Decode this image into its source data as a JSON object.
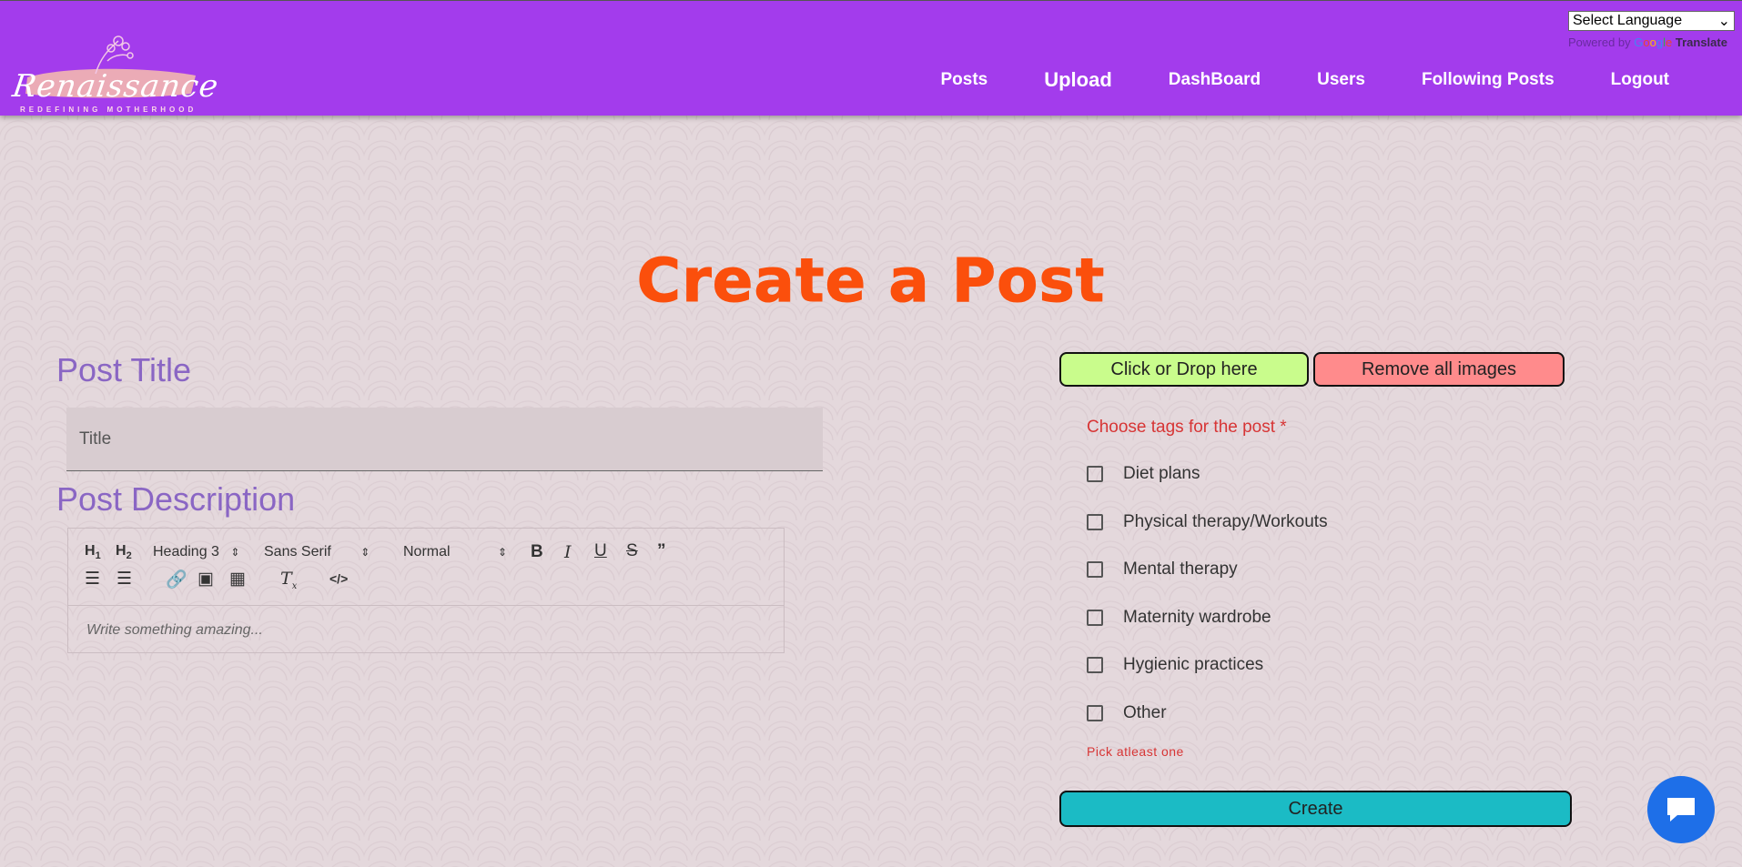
{
  "header": {
    "logo_text": "Renaissance",
    "logo_tagline": "REDEFINING MOTHERHOOD",
    "nav": [
      {
        "label": "Posts"
      },
      {
        "label": "Upload"
      },
      {
        "label": "DashBoard"
      },
      {
        "label": "Users"
      },
      {
        "label": "Following Posts"
      },
      {
        "label": "Logout"
      }
    ],
    "translate": {
      "select_label": "Select Language",
      "powered_by": "Powered by",
      "google": [
        "G",
        "o",
        "o",
        "g",
        "l",
        "e"
      ],
      "translate_label": "Translate"
    }
  },
  "page": {
    "title": "Create a Post"
  },
  "form": {
    "post_title_label": "Post Title",
    "title_placeholder": "Title",
    "post_description_label": "Post Description",
    "editor": {
      "header_select": "Heading 3",
      "font_select": "Sans Serif",
      "size_select": "Normal",
      "placeholder": "Write something amazing..."
    },
    "upload_button": "Click or Drop here",
    "remove_images_button": "Remove all images",
    "tags_label": "Choose tags for the post *",
    "tags": [
      {
        "label": "Diet plans",
        "checked": false
      },
      {
        "label": "Physical therapy/Workouts",
        "checked": false
      },
      {
        "label": "Mental therapy",
        "checked": false
      },
      {
        "label": "Maternity wardrobe",
        "checked": false
      },
      {
        "label": "Hygienic practices",
        "checked": false
      },
      {
        "label": "Other",
        "checked": false
      }
    ],
    "tags_error": "Pick atleast one",
    "create_button": "Create"
  },
  "colors": {
    "navbar": "#a33cec",
    "title": "#fb4f0c",
    "label": "#8a66c4",
    "upload_button": "#c9fc8c",
    "remove_button": "#ff8b8c",
    "create_button": "#1bbbc5",
    "error": "#d73535",
    "chat": "#1e6fe8"
  }
}
